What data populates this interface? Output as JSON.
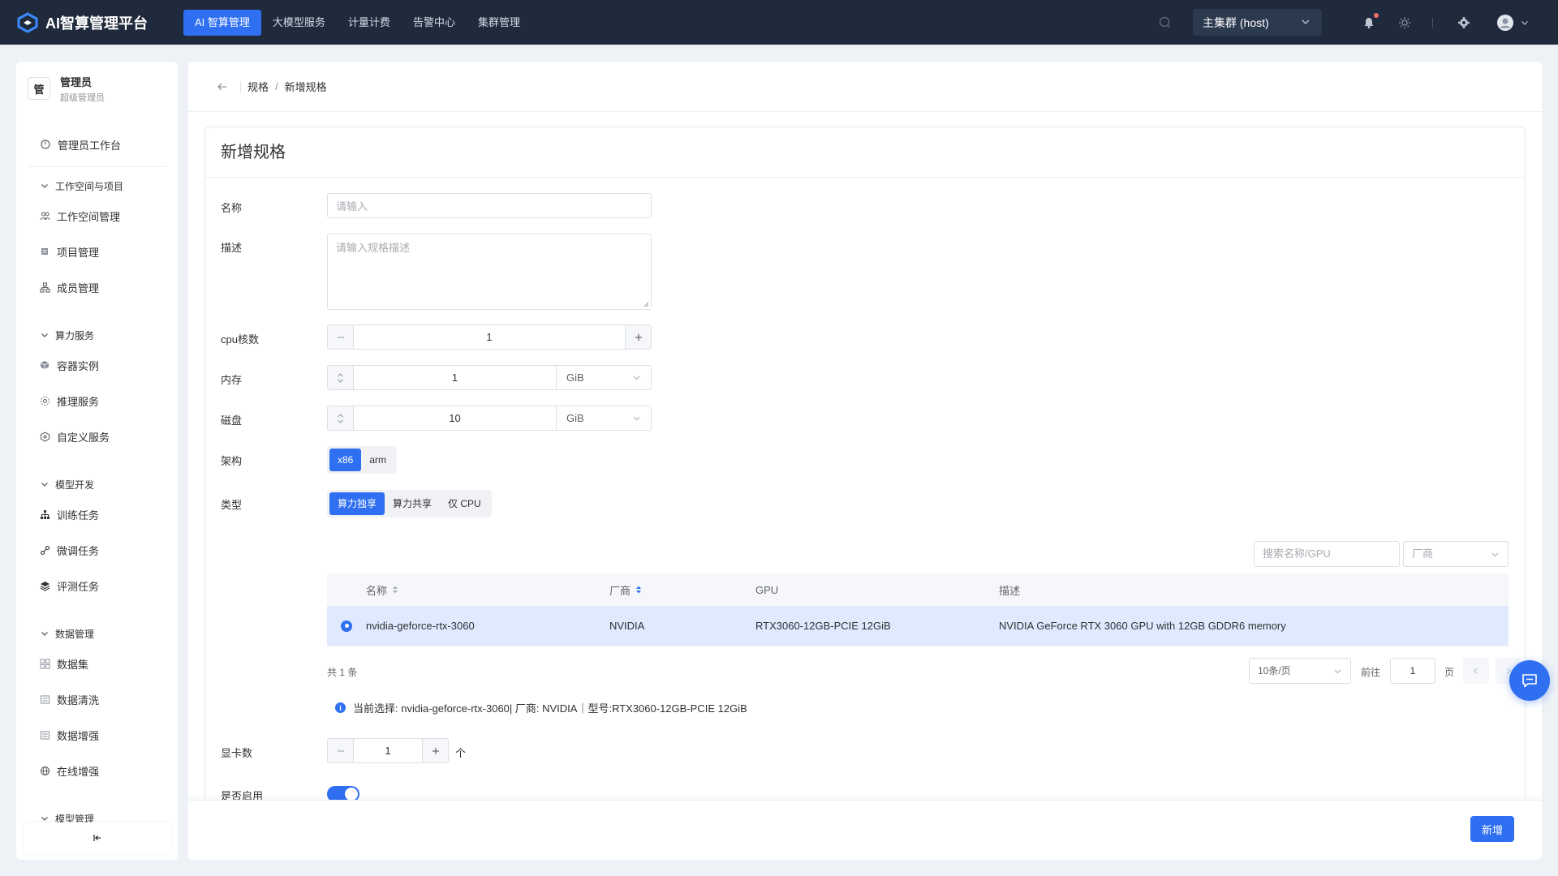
{
  "app": {
    "title": "AI智算管理平台"
  },
  "topnav": [
    {
      "label": "AI 智算管理",
      "active": true
    },
    {
      "label": "大模型服务",
      "active": false
    },
    {
      "label": "计量计费",
      "active": false
    },
    {
      "label": "告警中心",
      "active": false
    },
    {
      "label": "集群管理",
      "active": false
    }
  ],
  "header": {
    "cluster": "主集群 (host)",
    "icons": [
      "search-icon",
      "bell-icon",
      "sun-icon",
      "gear-icon",
      "user-avatar-icon"
    ]
  },
  "sidebar": {
    "user": {
      "initial": "管",
      "name": "管理员",
      "role": "超级管理员"
    },
    "workbench": "管理员工作台",
    "groups": [
      {
        "label": "工作空间与项目",
        "items": [
          "工作空间管理",
          "项目管理",
          "成员管理"
        ]
      },
      {
        "label": "算力服务",
        "items": [
          "容器实例",
          "推理服务",
          "自定义服务"
        ]
      },
      {
        "label": "模型开发",
        "items": [
          "训练任务",
          "微调任务",
          "评测任务"
        ]
      },
      {
        "label": "数据管理",
        "items": [
          "数据集",
          "数据清洗",
          "数据增强",
          "在线增强"
        ]
      },
      {
        "label": "模型管理",
        "items": []
      }
    ]
  },
  "breadcrumb": {
    "parent": "规格",
    "separator": "/",
    "current": "新增规格"
  },
  "form": {
    "title": "新增规格",
    "name_label": "名称",
    "name_placeholder": "请输入",
    "desc_label": "描述",
    "desc_placeholder": "请输入规格描述",
    "cpu_label": "cpu核数",
    "cpu_value": "1",
    "memory_label": "内存",
    "memory_value": "1",
    "memory_unit": "GiB",
    "disk_label": "磁盘",
    "disk_value": "10",
    "disk_unit": "GiB",
    "arch_label": "架构",
    "arch_options": [
      "x86",
      "arm"
    ],
    "arch_selected": "x86",
    "type_label": "类型",
    "type_options": [
      "算力独享",
      "算力共享",
      "仅 CPU"
    ],
    "type_selected": "算力独享",
    "gpu_search_placeholder": "搜索名称/GPU",
    "vendor_placeholder": "厂商",
    "gpu_count_label": "显卡数",
    "gpu_count_value": "1",
    "gpu_count_unit": "个",
    "enabled_label": "是否启用",
    "enabled": true
  },
  "gpu_table": {
    "columns": [
      "名称",
      "厂商",
      "GPU",
      "描述"
    ],
    "rows": [
      {
        "name": "nvidia-geforce-rtx-3060",
        "vendor": "NVIDIA",
        "gpu": "RTX3060-12GB-PCIE 12GiB",
        "desc": "NVIDIA GeForce RTX 3060 GPU with 12GB GDDR6 memory",
        "selected": true
      }
    ],
    "total": "共 1 条",
    "page_size": "10条/页",
    "goto_label": "前往",
    "page": "1",
    "page_suffix": "页"
  },
  "selection_info": "当前选择: nvidia-geforce-rtx-3060| 厂商: NVIDIA｜型号:RTX3060-12GB-PCIE 12GiB",
  "footer": {
    "submit_label": "新增"
  },
  "colors": {
    "primary": "#2f6ff1",
    "header_bg": "#1f2a3c",
    "selected_row": "#dfeaff"
  }
}
